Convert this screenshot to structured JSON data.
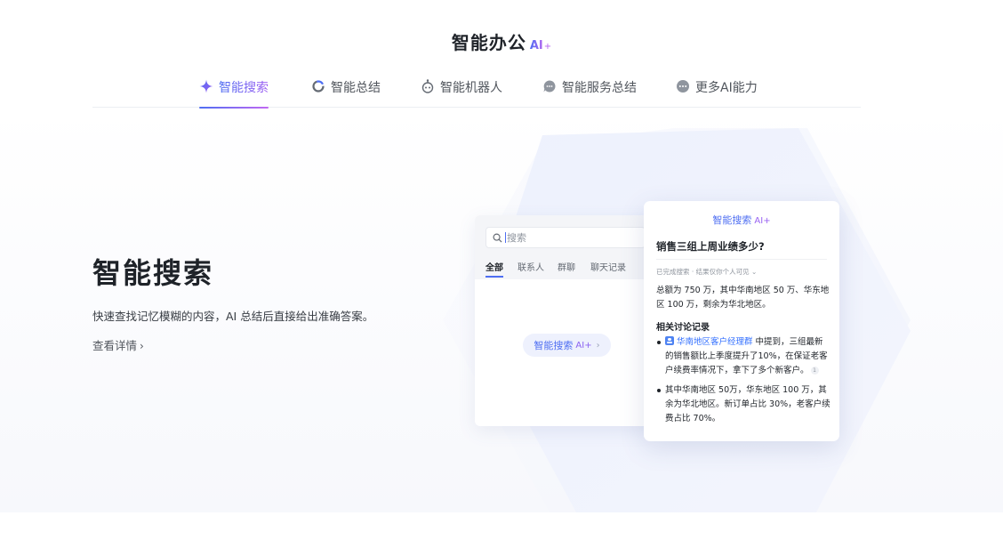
{
  "heading": {
    "title": "智能办公",
    "ai_badge": "AI",
    "ai_star": "+"
  },
  "tabs": [
    {
      "label": "智能搜索",
      "icon": "sparkle-icon",
      "active": true
    },
    {
      "label": "智能总结",
      "icon": "summary-ring-icon",
      "active": false
    },
    {
      "label": "智能机器人",
      "icon": "robot-icon",
      "active": false
    },
    {
      "label": "智能服务总结",
      "icon": "service-chat-icon",
      "active": false
    },
    {
      "label": "更多AI能力",
      "icon": "more-dots-icon",
      "active": false
    }
  ],
  "feature": {
    "title": "智能搜索",
    "description": "快速查找记忆模糊的内容，AI 总结后直接给出准确答案。",
    "link": "查看详情",
    "link_chevron": "›"
  },
  "app_card": {
    "search_placeholder": "搜索",
    "tabs": [
      "全部",
      "联系人",
      "群聊",
      "聊天记录"
    ],
    "pill": {
      "label": "智能搜索",
      "ai": "AI+",
      "chevron": "›"
    }
  },
  "result_card": {
    "header": "智能搜索",
    "header_ai": "AI+",
    "question": "销售三组上周业绩多少?",
    "status": "已完成搜索 · 结果仅你个人可见 ⌄",
    "answer": "总额为 750 万，其中华南地区 50 万、华东地区 100 万，剩余为华北地区。",
    "related_title": "相关讨论记录",
    "bullet1": {
      "group": "华南地区客户经理群",
      "text": " 中提到，三组最新的销售额比上季度提升了10%，在保证老客户续费率情况下，拿下了多个新客户。",
      "ref": "1"
    },
    "bullet2": "其中华南地区 50万，华东地区 100 万，其余为华北地区。新订单占比 30%，老客户续费占比 70%。"
  },
  "colors": {
    "brand": "#4e6ef2",
    "ai_gradient_end": "#b565f0",
    "link": "#3370ff",
    "hex_fill": "#eef2fd"
  }
}
